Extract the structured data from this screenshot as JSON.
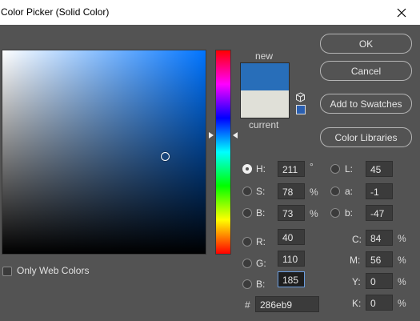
{
  "window": {
    "title": "Color Picker (Solid Color)"
  },
  "preview": {
    "new_label": "new",
    "current_label": "current",
    "new_color": "#286eb9",
    "current_color": "#e0e0d8"
  },
  "buttons": {
    "ok": "OK",
    "cancel": "Cancel",
    "add_to_swatches": "Add to Swatches",
    "color_libraries": "Color Libraries"
  },
  "hsb": [
    {
      "label": "H:",
      "value": "211",
      "unit": "°",
      "selected": true
    },
    {
      "label": "S:",
      "value": "78",
      "unit": "%",
      "selected": false
    },
    {
      "label": "B:",
      "value": "73",
      "unit": "%",
      "selected": false
    }
  ],
  "lab": [
    {
      "label": "L:",
      "value": "45"
    },
    {
      "label": "a:",
      "value": "-1"
    },
    {
      "label": "b:",
      "value": "-47"
    }
  ],
  "rgb": [
    {
      "label": "R:",
      "value": "40"
    },
    {
      "label": "G:",
      "value": "110"
    },
    {
      "label": "B:",
      "value": "185"
    }
  ],
  "cmyk": [
    {
      "label": "C:",
      "value": "84",
      "unit": "%"
    },
    {
      "label": "M:",
      "value": "56",
      "unit": "%"
    },
    {
      "label": "Y:",
      "value": "0",
      "unit": "%"
    },
    {
      "label": "K:",
      "value": "0",
      "unit": "%"
    }
  ],
  "hex": {
    "label": "#",
    "value": "286eb9"
  },
  "web_colors": {
    "label": "Only Web Colors",
    "checked": false
  },
  "colors": {
    "field_bg": "#0074ff",
    "accent": "#286eb9"
  }
}
